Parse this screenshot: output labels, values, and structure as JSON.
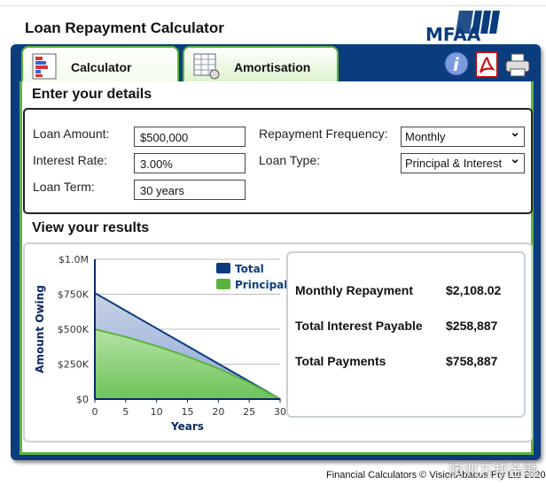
{
  "app": {
    "title": "Loan Repayment Calculator",
    "logo_text": "MFAA"
  },
  "tabs": [
    {
      "label": "Calculator",
      "icon": "calculator-icon",
      "active": true
    },
    {
      "label": "Amortisation",
      "icon": "table-gear-icon",
      "active": false
    }
  ],
  "toolbar": {
    "icons": [
      "info-icon",
      "pdf-icon",
      "printer-icon"
    ]
  },
  "details": {
    "heading": "Enter your details",
    "loan_amount": {
      "label": "Loan Amount:",
      "value": "$500,000"
    },
    "interest_rate": {
      "label": "Interest Rate:",
      "value": "3.00%"
    },
    "loan_term": {
      "label": "Loan Term:",
      "value": "30 years"
    },
    "repayment_frequency": {
      "label": "Repayment Frequency:",
      "value": "Monthly"
    },
    "loan_type": {
      "label": "Loan Type:",
      "value": "Principal & Interest"
    }
  },
  "results": {
    "heading": "View your results",
    "rows": [
      {
        "label": "Monthly Repayment",
        "value": "$2,108.02"
      },
      {
        "label": "Total Interest Payable",
        "value": "$258,887"
      },
      {
        "label": "Total Payments",
        "value": "$758,887"
      }
    ]
  },
  "chart_data": {
    "type": "area",
    "xlabel": "Years",
    "ylabel": "Amount Owing",
    "x": [
      0,
      5,
      10,
      15,
      20,
      25,
      30
    ],
    "xticks": [
      "0",
      "5",
      "10",
      "15",
      "20",
      "25",
      "30"
    ],
    "yticks": [
      "$0",
      "$250K",
      "$500K",
      "$750K",
      "$1.0M"
    ],
    "ylim": [
      0,
      1000000
    ],
    "xlim": [
      0,
      30
    ],
    "grid": true,
    "legend": "top-right",
    "series": [
      {
        "name": "Total",
        "color": "#0b3d7e",
        "values": [
          758887,
          632406,
          505925,
          379444,
          252962,
          126481,
          0
        ]
      },
      {
        "name": "Principal",
        "color": "#5cb43e",
        "values": [
          500000,
          444540,
          380080,
          305260,
          218290,
          117280,
          0
        ]
      }
    ]
  },
  "footer": "Financial Calculators © VisionAbacus Pty Ltd 2020",
  "watermark": "澳洲万邦金融"
}
